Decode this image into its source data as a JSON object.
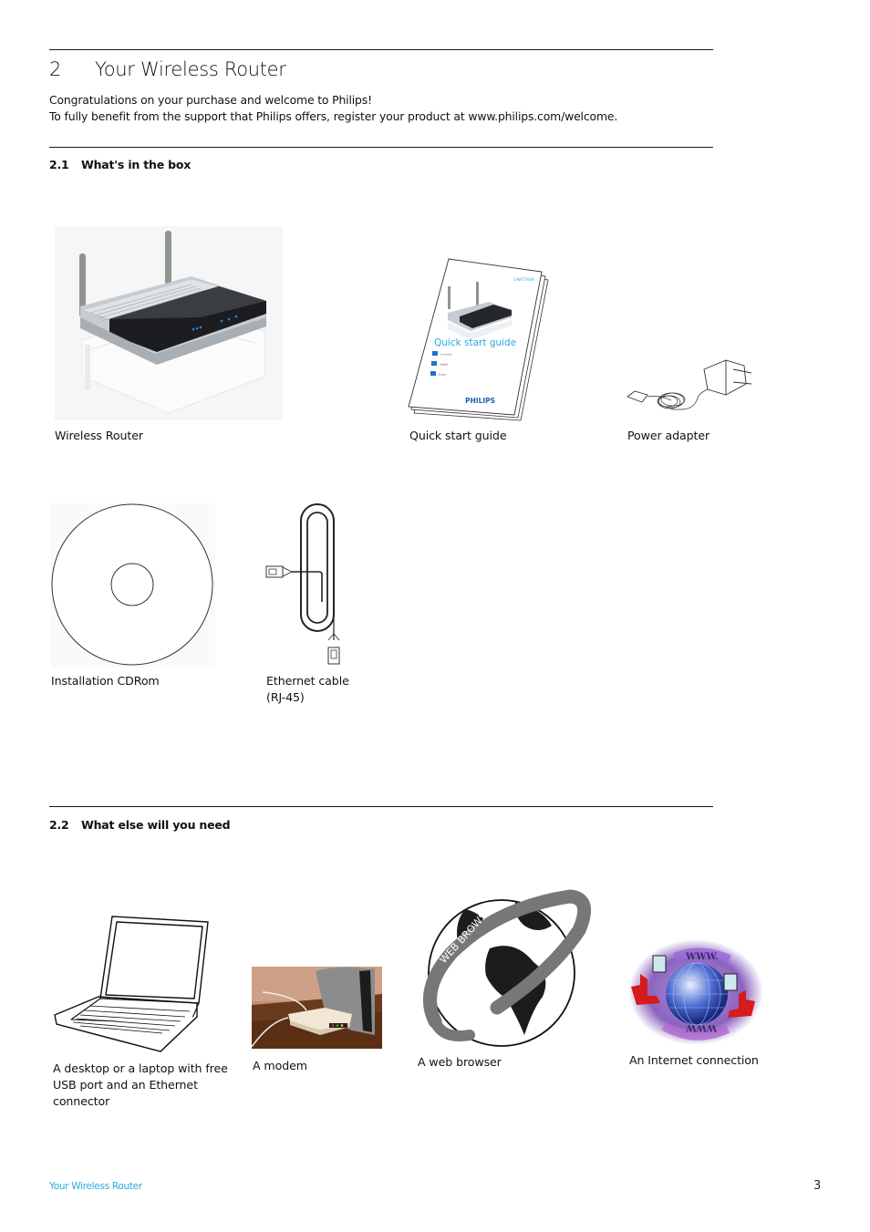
{
  "chapter": {
    "number": "2",
    "title": "Your Wireless Router"
  },
  "intro": {
    "line1": "Congratulations on your purchase and welcome to Philips!",
    "line2": "To fully benefit from the support that Philips offers, register your product at www.philips.com/welcome."
  },
  "section_1": {
    "number": "2.1",
    "title": "What's in the box",
    "items": [
      {
        "caption": "Wireless Router",
        "icon": "wireless-router-image"
      },
      {
        "caption": "Quick start guide",
        "icon": "quick-start-guide-image"
      },
      {
        "caption": "Power adapter",
        "icon": "power-adapter-image"
      },
      {
        "caption": "Installation CDRom",
        "icon": "cdrom-image"
      },
      {
        "caption_line1": "Ethernet cable",
        "caption_line2": "(RJ-45)",
        "icon": "ethernet-cable-image"
      }
    ],
    "guide_cover": {
      "title": "Quick start guide",
      "model": "CAW7740N",
      "steps": [
        "Connect",
        "Install",
        "Enjoy"
      ],
      "step_numbers": [
        "1",
        "2",
        "3"
      ],
      "brand": "PHILIPS"
    }
  },
  "section_2": {
    "number": "2.2",
    "title": "What else will you need",
    "items": [
      {
        "caption_lines": [
          "A desktop or a laptop with free",
          "USB port and an Ethernet",
          "connector"
        ],
        "icon": "laptop-image"
      },
      {
        "caption": "A modem",
        "icon": "modem-image"
      },
      {
        "caption": "A web browser",
        "icon": "web-browser-globe-image",
        "ring_text": "WEB BROWSER"
      },
      {
        "caption": "An Internet connection",
        "icon": "internet-connection-image",
        "top_text": "WWW.",
        "bottom_text": "WWW"
      }
    ]
  },
  "footer": {
    "running_title": "Your Wireless Router",
    "page_number": "3"
  },
  "colors": {
    "accent_blue": "#2aa9e0",
    "rule": "#1a1a1a"
  }
}
